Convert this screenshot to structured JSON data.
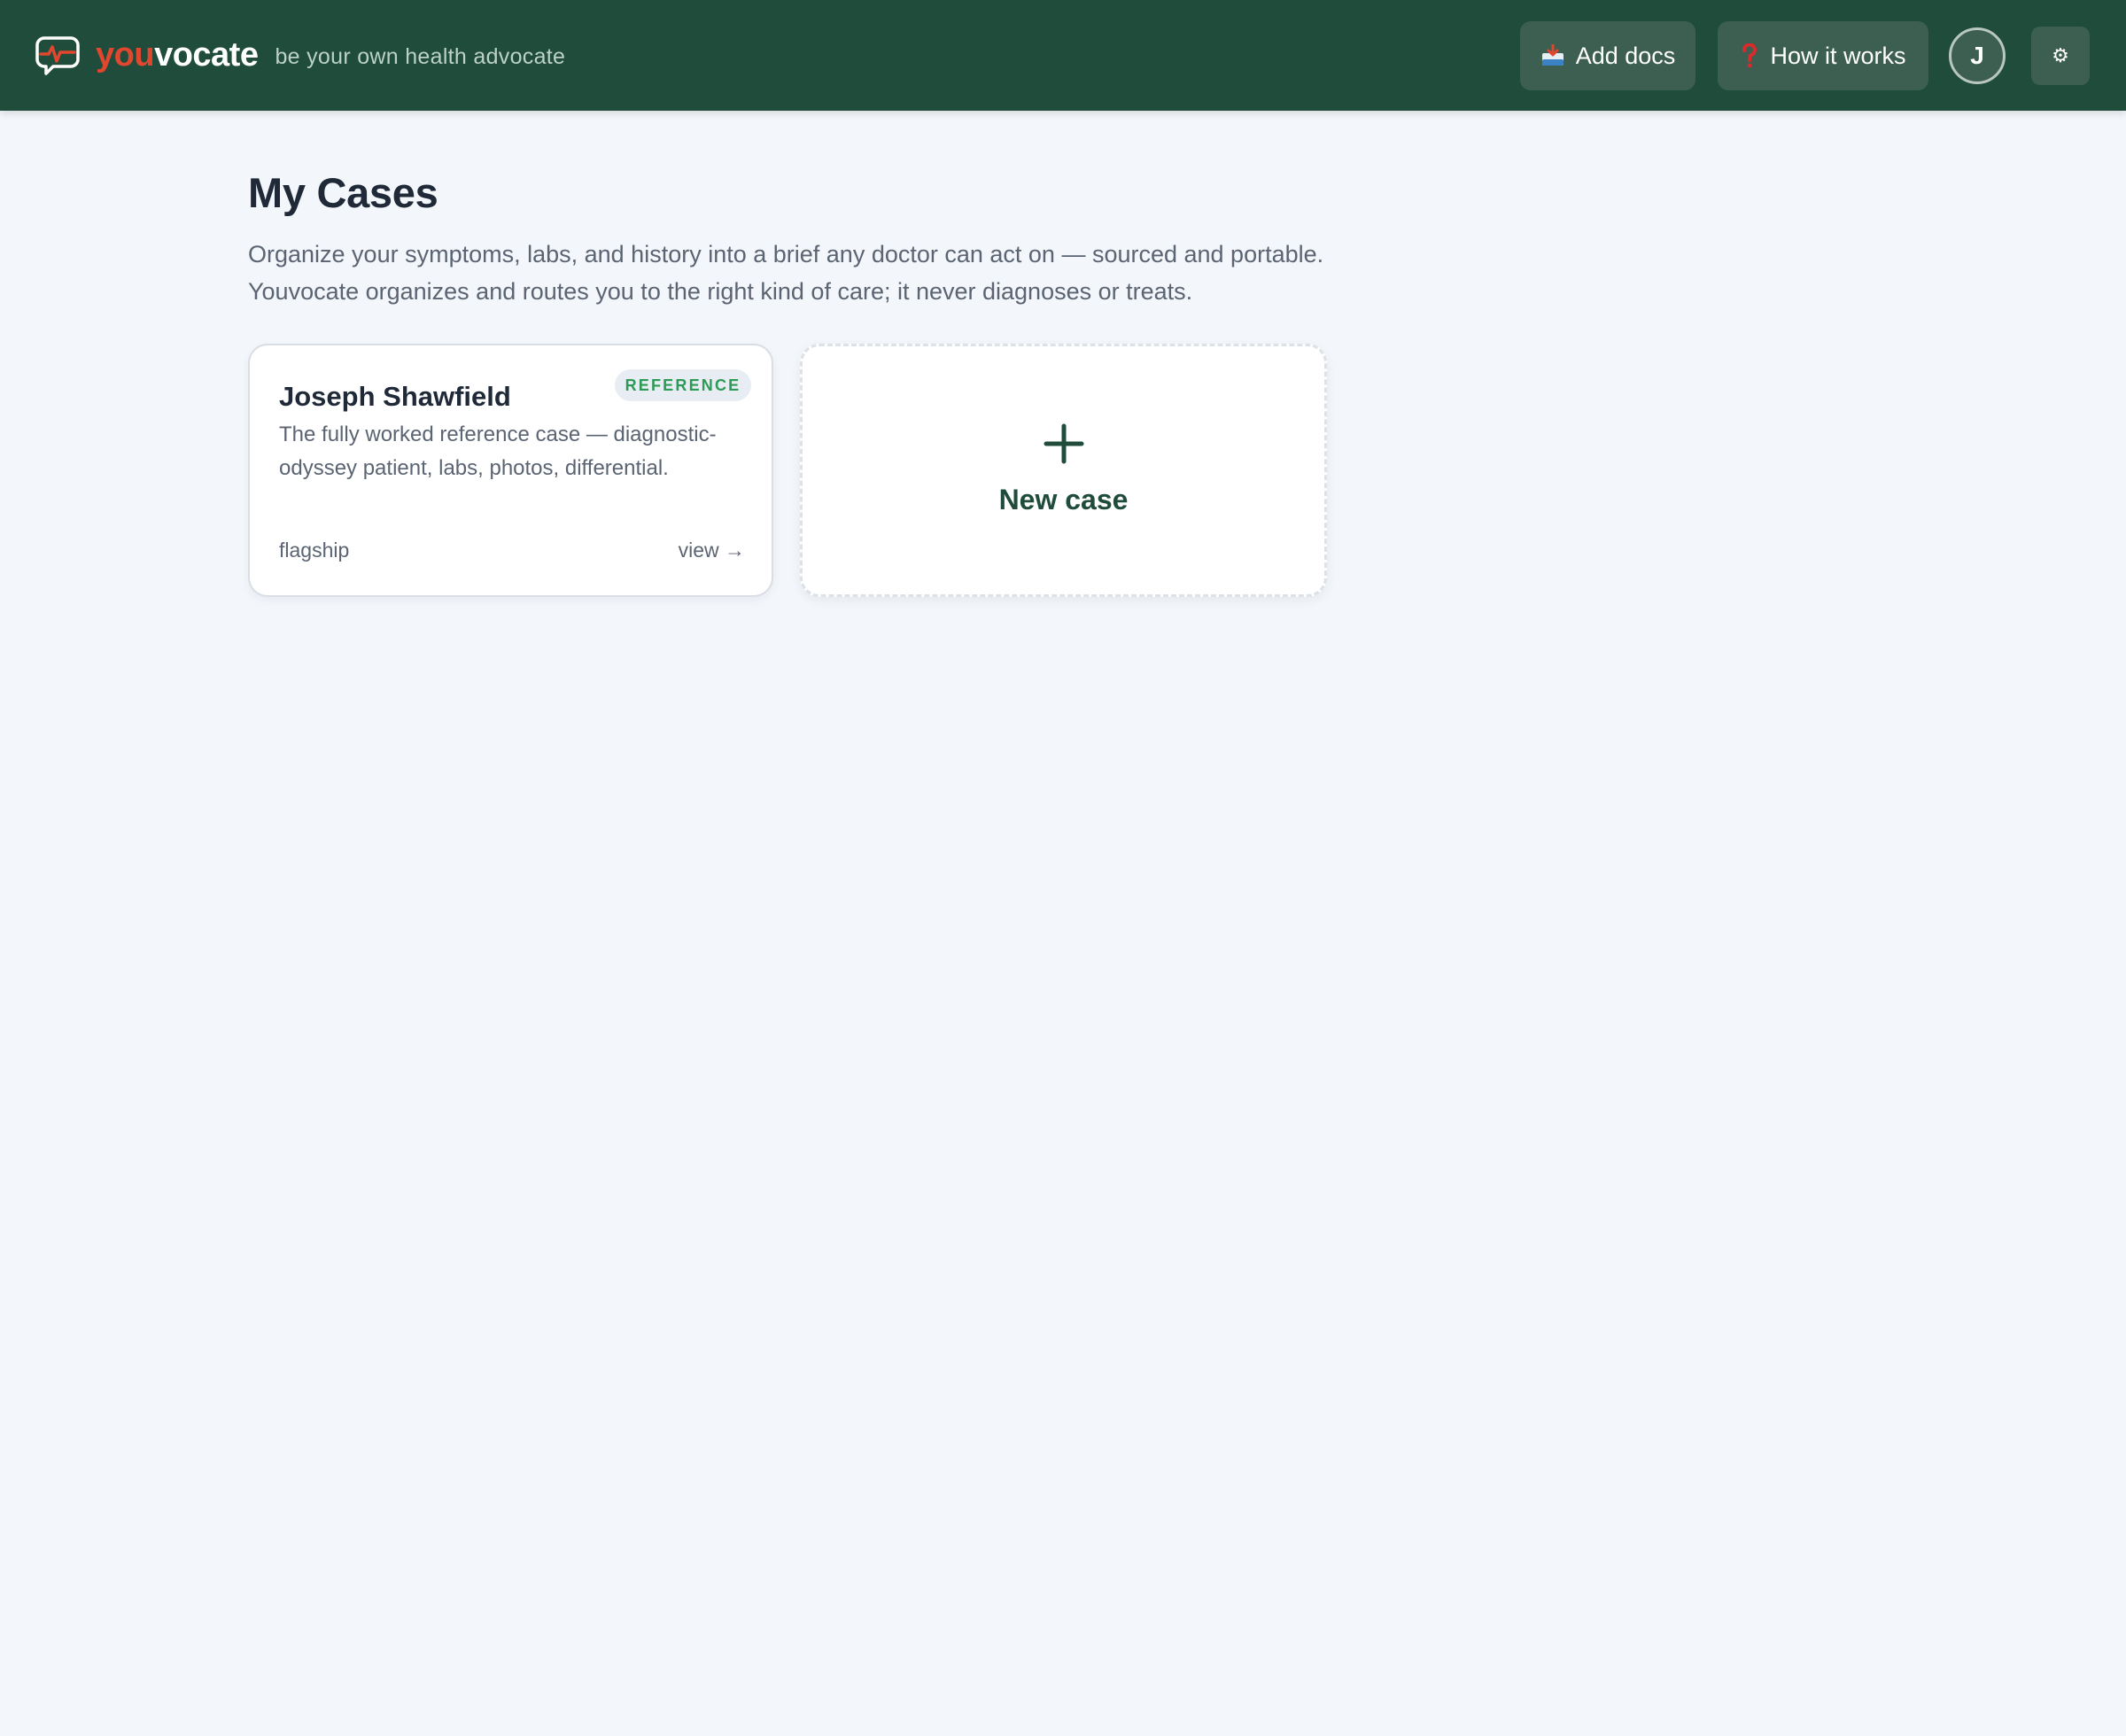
{
  "header": {
    "logo_you": "you",
    "logo_vocate": "vocate",
    "tagline": "be your own health advocate",
    "add_docs_label": "Add docs",
    "add_docs_icon": "inbox-tray-icon",
    "how_it_works_label": "How it works",
    "how_it_works_icon": "red-question-mark-icon",
    "avatar_initial": "J",
    "settings_icon": "⚙",
    "colors": {
      "bar": "#204c3b",
      "button": "#3c5f52",
      "logo_accent": "#e1472f"
    }
  },
  "main": {
    "title": "My Cases",
    "description_line1": "Organize your symptoms, labs, and history into a brief any doctor can act on — sourced and portable.",
    "description_line2": "Youvocate organizes and routes you to the right kind of care; it never diagnoses or treats."
  },
  "cases": [
    {
      "name": "Joseph Shawfield",
      "badge": "REFERENCE",
      "description": "The fully worked reference case — diagnostic-odyssey patient, labs, photos, differential.",
      "tag": "flagship",
      "view_label": "view →"
    }
  ],
  "new_case": {
    "label": "New case",
    "icon": "plus-icon"
  },
  "colors": {
    "background": "#f3f6fa",
    "badge_text": "#2e9a58",
    "new_case_text": "#204c3b"
  }
}
